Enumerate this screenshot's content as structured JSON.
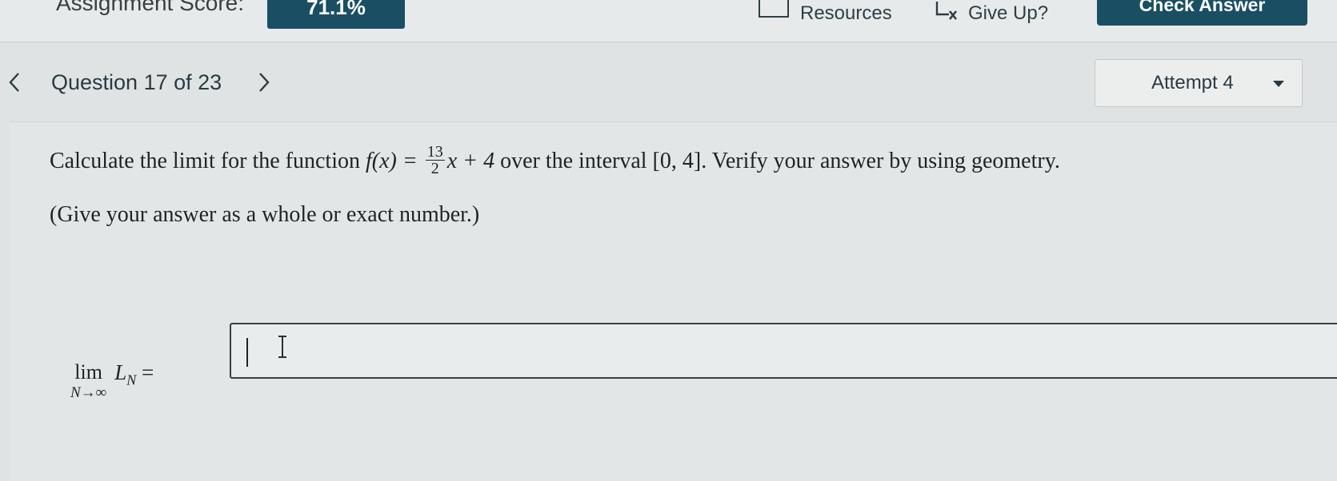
{
  "topbar": {
    "score_label": "Assignment Score:",
    "score_value": "71.1%",
    "resources_label": "Resources",
    "resources_icon": "resources-icon",
    "giveup_label": "Give Up?",
    "giveup_icon": "give-up-icon",
    "check_answer_label": "Check Answer"
  },
  "nav": {
    "question_label": "Question 17 of 23",
    "prev_icon": "chevron-left-icon",
    "next_icon": "chevron-right-icon",
    "attempt_label": "Attempt 4",
    "attempt_caret_icon": "caret-down-icon"
  },
  "question": {
    "text_before": "Calculate the limit for the function ",
    "func_name": "f(x) = ",
    "frac_num": "13",
    "frac_den": "2",
    "func_rest": "x + 4",
    "text_after": " over the interval [0, 4]. Verify your answer by using geometry.",
    "hint": "(Give your answer as a whole or exact number.)"
  },
  "answer": {
    "lim_word": "lim",
    "lim_sub": "N→∞",
    "lim_rest": "L",
    "lim_rest_sub": "N",
    "equals": " =",
    "value": "",
    "placeholder": ""
  },
  "colors": {
    "accent": "#1a4f63",
    "background": "#dfe3e3",
    "text": "#1f2326"
  }
}
